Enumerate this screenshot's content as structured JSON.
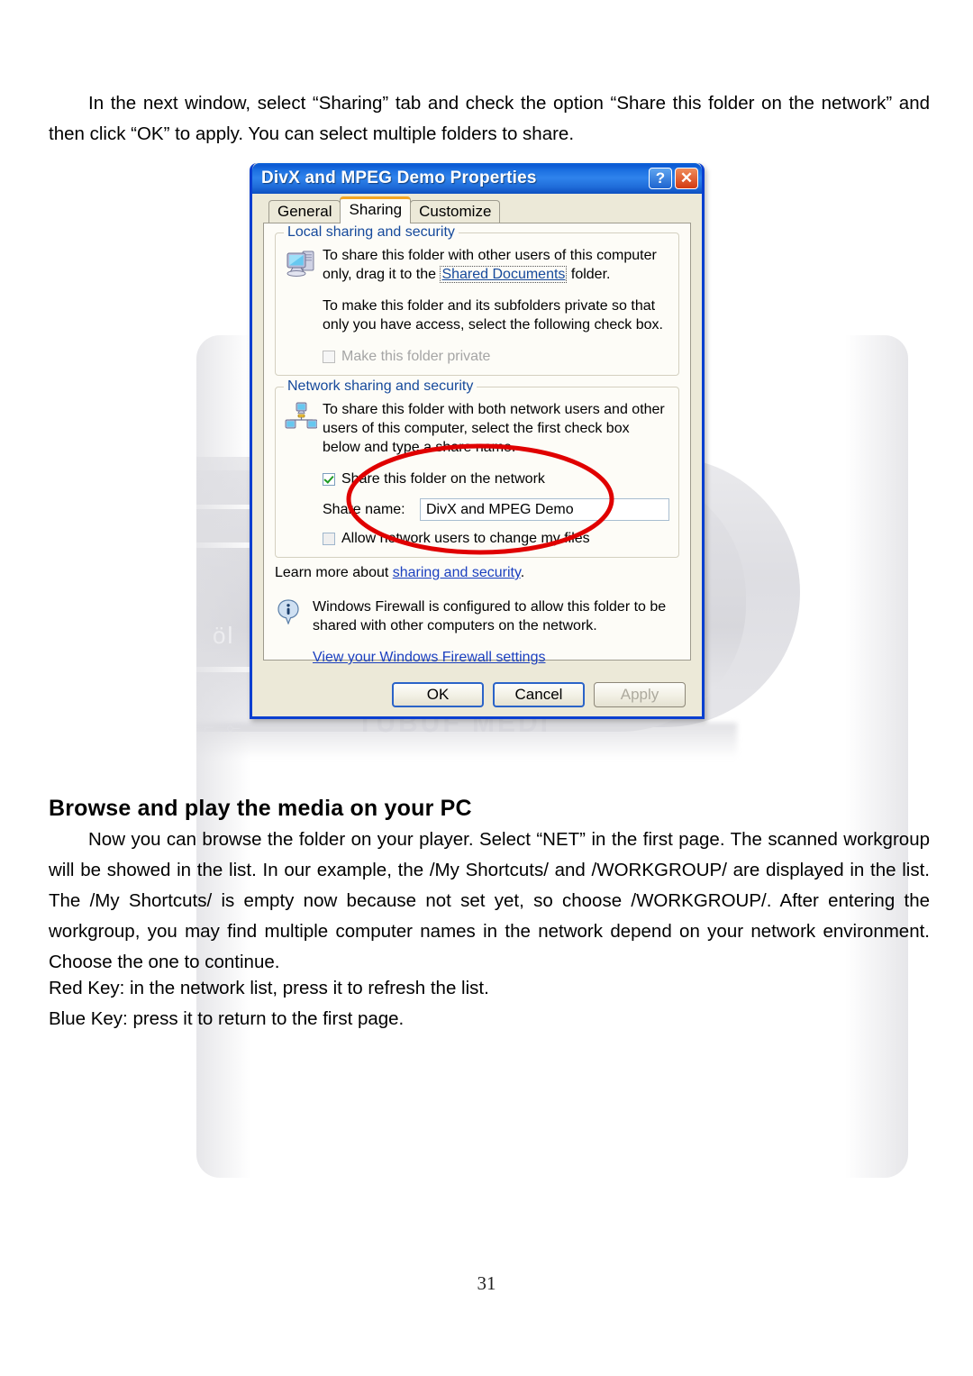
{
  "document": {
    "intro_paragraph": "In the next window, select “Sharing” tab and check the option “Share this folder on the network” and then click “OK” to apply. You can select multiple folders to share.",
    "section_heading": "Browse and play the media on your PC",
    "browse_paragraph": "Now you can browse the folder on your player. Select “NET” in the first page. The scanned workgroup will be showed in the list. In our example, the /My Shortcuts/ and /WORKGROUP/ are displayed in the list. The /My Shortcuts/ is empty now because not set yet, so choose /WORKGROUP/. After entering the workgroup, you may find multiple computer names in the network depend on your network environment. Choose the one to continue.",
    "red_key_line": "Red Key: in the network list, press it to refresh the list.",
    "blue_key_line": "Blue Key: press it to return to the first page.",
    "page_number": "31"
  },
  "watermark": {
    "device_label": "öl",
    "usb_label": "⌐ ⟜",
    "brand_label": "TUBUF MEDI"
  },
  "dialog": {
    "title": "DivX and MPEG Demo Properties",
    "help_button": "?",
    "close_button": "✕",
    "tabs": [
      {
        "label": "General",
        "active": false
      },
      {
        "label": "Sharing",
        "active": true
      },
      {
        "label": "Customize",
        "active": false
      }
    ],
    "local_sharing": {
      "group_title": "Local sharing and security",
      "icon": "computer-icon",
      "text_1_before": "To share this folder with other users of this computer only, drag it to the ",
      "text_1_link": "Shared Documents",
      "text_1_after": " folder.",
      "text_2": "To make this folder and its subfolders private so that only you have access, select the following check box.",
      "private_checkbox_label": "Make this folder private",
      "private_checkbox_checked": false,
      "private_checkbox_enabled": false
    },
    "network_sharing": {
      "group_title": "Network sharing and security",
      "icon": "network-computers-icon",
      "text_1": "To share this folder with both network users and other users of this computer, select the first check box below and type a share name.",
      "share_checkbox_label": "Share this folder on the network",
      "share_checkbox_checked": true,
      "share_name_label": "Share name:",
      "share_name_value": "DivX and MPEG Demo",
      "allow_change_label": "Allow network users to change my files",
      "allow_change_checked": false,
      "learn_more_before": "Learn more about ",
      "learn_more_link": "sharing and security",
      "learn_more_after": "."
    },
    "firewall_notice": {
      "icon": "info-icon",
      "text": "Windows Firewall is configured to allow this folder to be shared with other computers on the network.",
      "link": "View your Windows Firewall settings"
    },
    "buttons": {
      "ok": "OK",
      "cancel": "Cancel",
      "apply": "Apply",
      "apply_enabled": false
    },
    "annotation": {
      "shape": "red-ellipse",
      "color": "#e00000"
    }
  }
}
